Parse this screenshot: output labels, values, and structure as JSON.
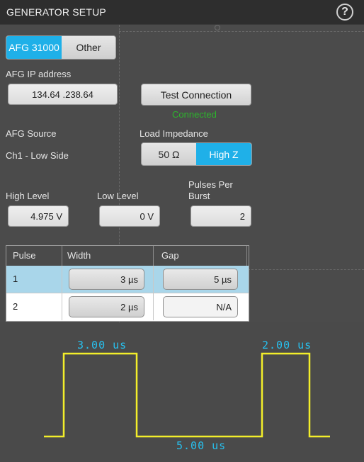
{
  "window": {
    "title": "GENERATOR SETUP"
  },
  "icons": {
    "help": "help-icon"
  },
  "instrument_selector": {
    "options": [
      "AFG 31000",
      "Other"
    ],
    "selected": "AFG 31000"
  },
  "ip": {
    "label": "AFG IP address",
    "value": "134.64 .238.64"
  },
  "test_connection": {
    "label": "Test Connection",
    "status": "Connected",
    "status_color": "#2cb52c"
  },
  "source": {
    "label": "AFG Source",
    "value": "Ch1 - Low Side"
  },
  "load_impedance": {
    "label": "Load Impedance",
    "options": [
      "50 Ω",
      "High Z"
    ],
    "selected": "High Z"
  },
  "levels": {
    "high_label": "High Level",
    "high_value": "4.975 V",
    "low_label": "Low Level",
    "low_value": "0 V",
    "ppb_label_1": "Pulses Per",
    "ppb_label_2": "Burst",
    "ppb_value": "2"
  },
  "pulse_table": {
    "headers": [
      "Pulse",
      "Width",
      "Gap"
    ],
    "rows": [
      {
        "pulse": "1",
        "width": "3 µs",
        "gap": "5 µs",
        "selected": true
      },
      {
        "pulse": "2",
        "width": "2 µs",
        "gap": "N/A",
        "selected": false
      }
    ]
  },
  "waveform": {
    "labels": {
      "pulse1_width": "3.00 us",
      "gap": "5.00 us",
      "pulse2_width": "2.00 us"
    },
    "line_color": "#f3ee2a",
    "label_color": "#27c0ee"
  },
  "colors": {
    "accent": "#1fb0e8",
    "selected_row": "#a9d6ea"
  }
}
